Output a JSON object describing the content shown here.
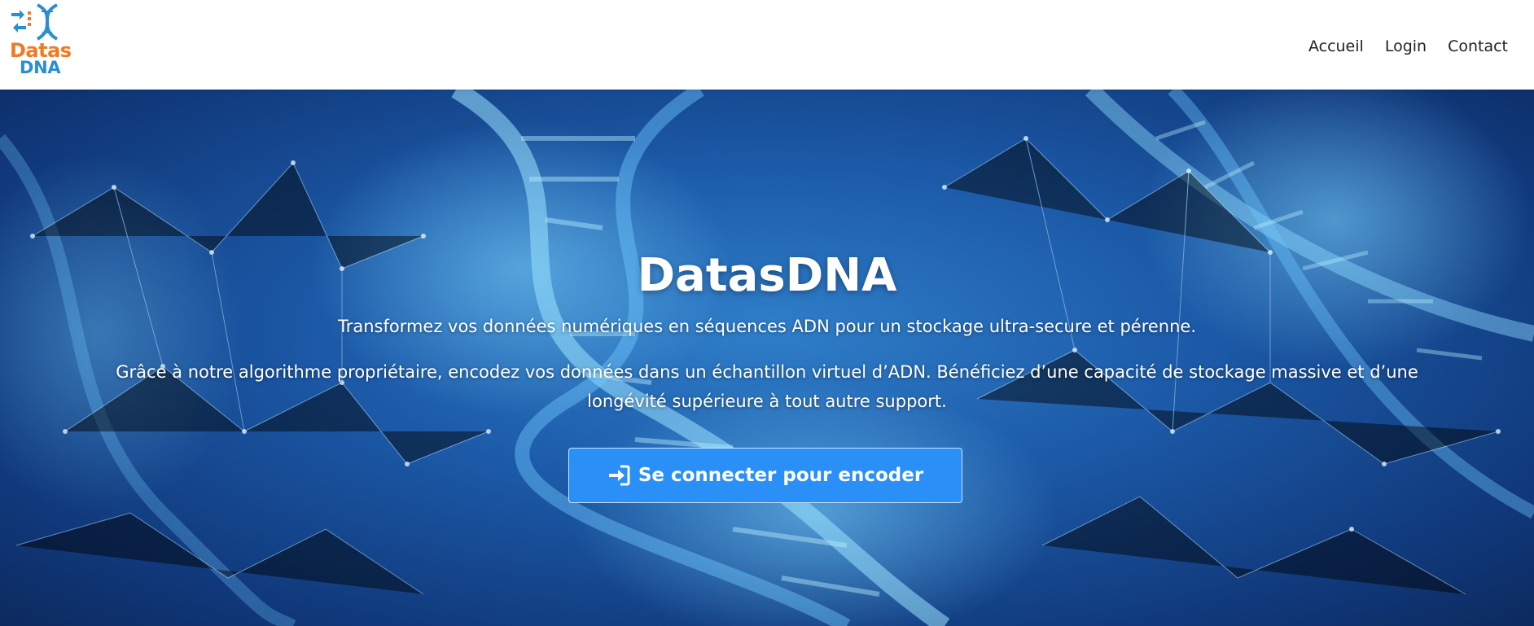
{
  "brand": {
    "line1": "Datas",
    "line2": "DNA",
    "colors": {
      "orange": "#f07a22",
      "blue": "#2a8fd0"
    }
  },
  "nav": {
    "items": [
      {
        "label": "Accueil"
      },
      {
        "label": "Login"
      },
      {
        "label": "Contact"
      }
    ]
  },
  "hero": {
    "title": "DatasDNA",
    "subtitle": "Transformez vos données numériques en séquences ADN pour un stockage ultra-secure et pérenne.",
    "description": "Grâce à notre algorithme propriétaire, encodez vos données dans un échantillon virtuel d’ADN. Bénéficiez d’une capacité de stockage massive et d’une longévité supérieure à tout autre support.",
    "cta": {
      "label": "Se connecter pour encoder",
      "icon": "sign-in-icon",
      "color": "#2a8ff7"
    },
    "background": "dna-helix-network-image"
  }
}
